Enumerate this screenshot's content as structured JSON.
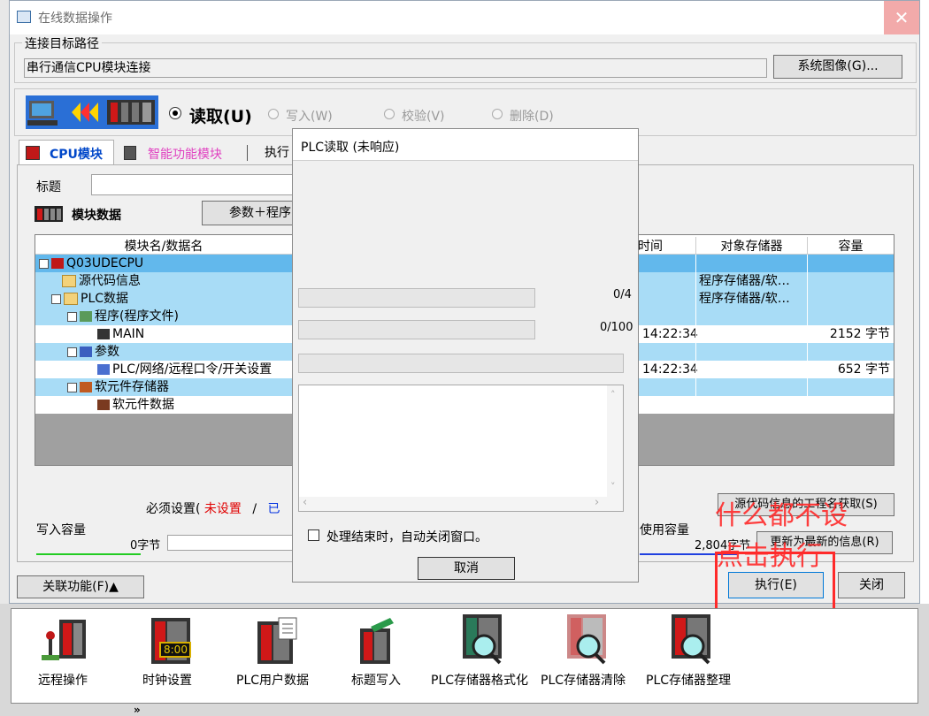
{
  "window": {
    "title": "在线数据操作",
    "close": "✕"
  },
  "connection": {
    "group_label": "连接目标路径",
    "value": "串行通信CPU模块连接",
    "system_image_button": "系统图像(G)..."
  },
  "operations": {
    "read": "读取(U)",
    "write": "写入(W)",
    "verify": "校验(V)",
    "delete": "删除(D)"
  },
  "tabs": {
    "cpu": "CPU模块",
    "intelligent": "智能功能模块",
    "execute": "执行"
  },
  "title_field": {
    "label": "标题",
    "value": ""
  },
  "module_data": {
    "label": "模块数据",
    "param_program_button": "参数＋程序"
  },
  "table": {
    "headers": {
      "name": "模块名/数据名",
      "time": "时间",
      "target": "对象存储器",
      "size": "容量"
    },
    "rows": [
      {
        "name": "Q03UDECPU",
        "time": "",
        "target": "",
        "size": ""
      },
      {
        "name": "源代码信息",
        "time": "",
        "target": "程序存储器/软…",
        "size": ""
      },
      {
        "name": "PLC数据",
        "time": "",
        "target": "程序存储器/软…",
        "size": ""
      },
      {
        "name": "程序(程序文件)",
        "time": "",
        "target": "",
        "size": ""
      },
      {
        "name": "MAIN",
        "time": "14:22:34",
        "target": "",
        "size": "2152 字节"
      },
      {
        "name": "参数",
        "time": "",
        "target": "",
        "size": ""
      },
      {
        "name": "PLC/网络/远程口令/开关设置",
        "time": "14:22:34",
        "target": "",
        "size": "652 字节"
      },
      {
        "name": "软元件存储器",
        "time": "",
        "target": "",
        "size": ""
      },
      {
        "name": "软元件数据",
        "time": "",
        "target": "",
        "size": ""
      }
    ]
  },
  "required": {
    "prefix": "必须设置(",
    "unset": "未设置",
    "slash": "/",
    "set_partial": "已"
  },
  "capacity": {
    "write_label": "写入容量",
    "write_value": "0字节",
    "used_label": "使用容量",
    "used_value": "2,804字节",
    "refresh_button": "更新为最新的信息(R)"
  },
  "source_info_button": "源代码信息的工程名获取(S)",
  "related_button": "关联功能(F)▲",
  "execute_button": "执行(E)",
  "close_button": "关闭",
  "dialog": {
    "title": "PLC读取 (未响应)",
    "progress1": "0/4",
    "progress2": "0/100",
    "auto_close": "处理结束时，自动关闭窗口。",
    "cancel_button": "取消"
  },
  "annotation": {
    "line1": "什么都不设",
    "line2": "点击执行",
    "color": "#ff2a2a"
  },
  "toolbar": {
    "items": [
      {
        "label": "远程操作"
      },
      {
        "label": "时钟设置",
        "clock": "8:00"
      },
      {
        "label": "PLC用户数据"
      },
      {
        "label": "标题写入"
      },
      {
        "label": "PLC存储器格式化"
      },
      {
        "label": "PLC存储器清除"
      },
      {
        "label": "PLC存储器整理"
      }
    ],
    "more": "»"
  }
}
